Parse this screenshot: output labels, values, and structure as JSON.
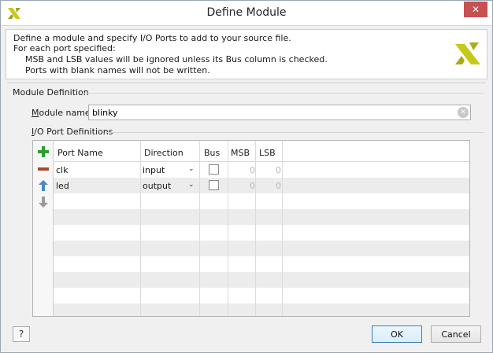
{
  "window": {
    "title": "Define Module"
  },
  "info": {
    "line1": "Define a module and specify I/O Ports to add to your source file.",
    "line2": "For each port specified:",
    "line3": "MSB and LSB values will be ignored unless its Bus column is checked.",
    "line4": "Ports with blank names will not be written."
  },
  "module_definition": {
    "section_title": "Module Definition",
    "name_label_prefix": "M",
    "name_label_rest": "odule name:",
    "name_value": "blinky"
  },
  "ports": {
    "section_title_prefix": "I",
    "section_title_rest": "/O Port Definitions",
    "columns": {
      "port_name": "Port Name",
      "direction": "Direction",
      "bus": "Bus",
      "msb": "MSB",
      "lsb": "LSB"
    },
    "rows": [
      {
        "name": "clk",
        "direction": "input",
        "msb": "0",
        "lsb": "0"
      },
      {
        "name": "led",
        "direction": "output",
        "msb": "0",
        "lsb": "0"
      }
    ]
  },
  "buttons": {
    "help": "?",
    "ok": "OK",
    "cancel": "Cancel"
  },
  "icons": {
    "close": "close-icon",
    "add": "plus-icon",
    "remove": "minus-icon",
    "up": "arrow-up-icon",
    "down": "arrow-down-icon",
    "clear": "clear-icon"
  },
  "colors": {
    "add": "#2e9e2e",
    "remove": "#a94a2a",
    "up": "#4a86c8",
    "down": "#9a9a9a",
    "logo": "#c6c91a",
    "close_bg": "#c75050"
  }
}
